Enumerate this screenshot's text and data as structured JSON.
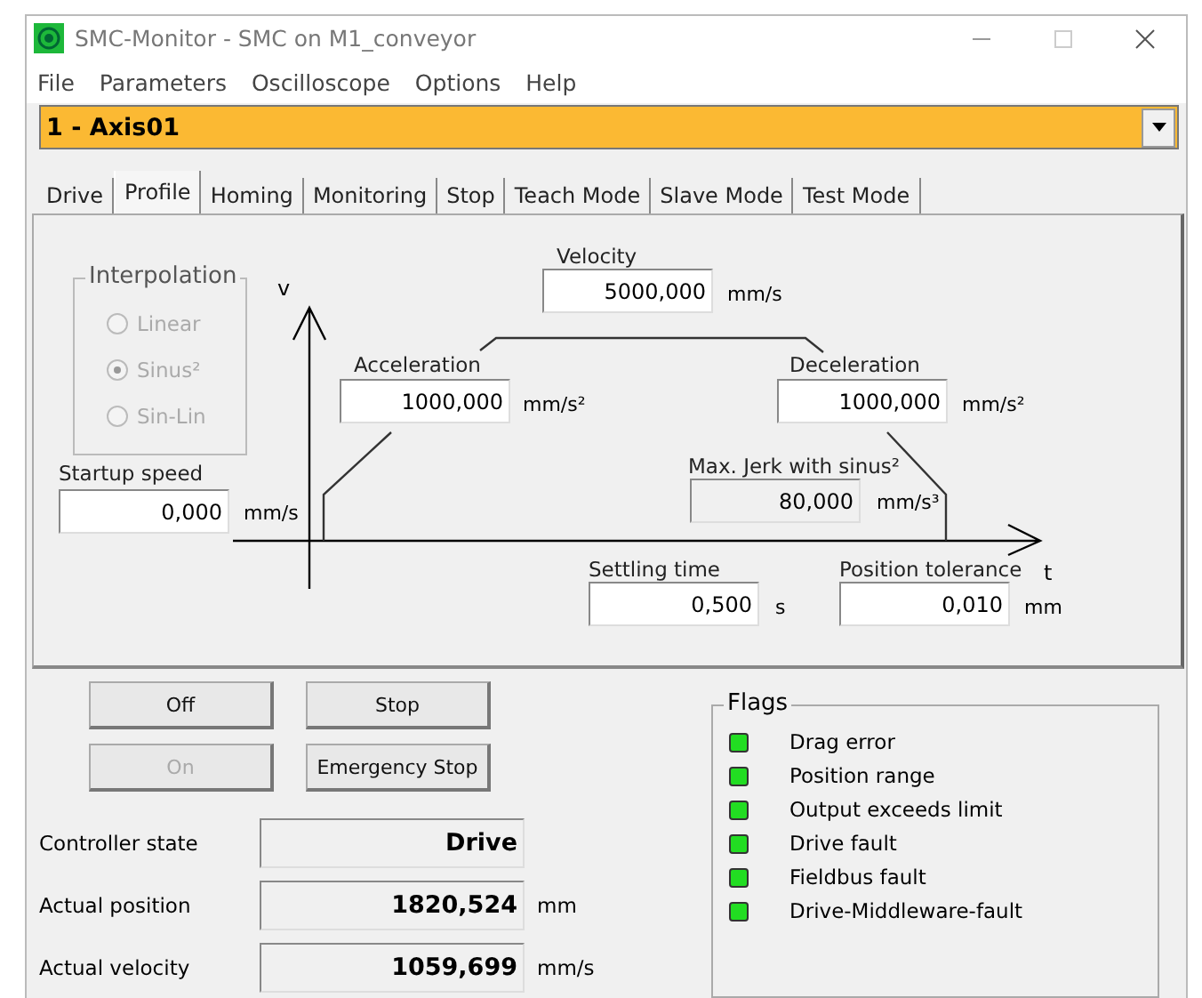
{
  "window": {
    "title": "SMC-Monitor - SMC on M1_conveyor"
  },
  "menu": [
    "File",
    "Parameters",
    "Oscilloscope",
    "Options",
    "Help"
  ],
  "axis_selector": {
    "value": "1 - Axis01"
  },
  "tabs": [
    {
      "label": "Drive",
      "selected": false
    },
    {
      "label": "Profile",
      "selected": true
    },
    {
      "label": "Homing",
      "selected": false
    },
    {
      "label": "Monitoring",
      "selected": false
    },
    {
      "label": "Stop",
      "selected": false
    },
    {
      "label": "Teach Mode",
      "selected": false
    },
    {
      "label": "Slave Mode",
      "selected": false
    },
    {
      "label": "Test Mode",
      "selected": false
    }
  ],
  "profile": {
    "interpolation": {
      "title": "Interpolation",
      "disabled": true,
      "options": [
        {
          "label": "Linear",
          "selected": false
        },
        {
          "label": "Sinus²",
          "selected": true
        },
        {
          "label": "Sin-Lin",
          "selected": false
        }
      ]
    },
    "axis_labels": {
      "y": "v",
      "x": "t"
    },
    "fields": [
      {
        "label": "Velocity",
        "value": "5000,000",
        "unit": "mm/s",
        "readonly": false
      },
      {
        "label": "Acceleration",
        "value": "1000,000",
        "unit": "mm/s²",
        "readonly": false
      },
      {
        "label": "Deceleration",
        "value": "1000,000",
        "unit": "mm/s²",
        "readonly": false
      },
      {
        "label": "Startup speed",
        "value": "0,000",
        "unit": "mm/s",
        "readonly": false
      },
      {
        "label": "Max. Jerk with sinus²",
        "value": "80,000",
        "unit": "mm/s³",
        "readonly": true
      },
      {
        "label": "Settling time",
        "value": "0,500",
        "unit": "s",
        "readonly": false
      },
      {
        "label": "Position tolerance",
        "value": "0,010",
        "unit": "mm",
        "readonly": false
      }
    ]
  },
  "buttons": [
    {
      "label": "Off",
      "disabled": false
    },
    {
      "label": "Stop",
      "disabled": false
    },
    {
      "label": "On",
      "disabled": true
    },
    {
      "label": "Emergency Stop",
      "disabled": false
    }
  ],
  "status": [
    {
      "label": "Controller state",
      "value": "Drive"
    },
    {
      "label": "Actual position",
      "value": "1820,524",
      "unit": "mm"
    },
    {
      "label": "Actual velocity",
      "value": "1059,699",
      "unit": "mm/s"
    }
  ],
  "flags": {
    "title": "Flags",
    "items": [
      {
        "label": "Drag error",
        "color": "#22dd22"
      },
      {
        "label": "Position range",
        "color": "#22dd22"
      },
      {
        "label": "Output exceeds limit",
        "color": "#22dd22"
      },
      {
        "label": "Drive fault",
        "color": "#22dd22"
      },
      {
        "label": "Fieldbus fault",
        "color": "#22dd22"
      },
      {
        "label": "Drive-Middleware-fault",
        "color": "#22dd22"
      }
    ]
  }
}
